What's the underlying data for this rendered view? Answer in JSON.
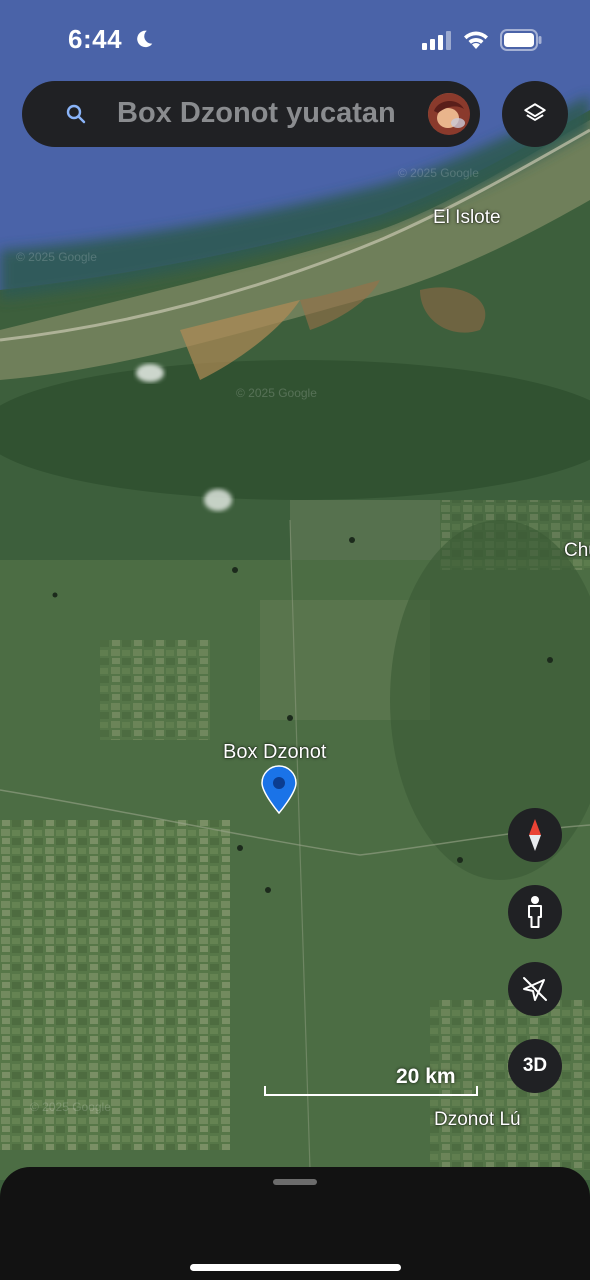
{
  "status_bar": {
    "time": "6:44",
    "icons": [
      "moon-icon",
      "cellular-signal-icon",
      "wifi-icon",
      "battery-icon"
    ]
  },
  "search": {
    "query": "Box Dzonot yucatan",
    "icon": "search-icon"
  },
  "controls": {
    "layers_icon": "layers-icon",
    "compass_icon": "compass-icon",
    "street_view_icon": "pegman-icon",
    "location_icon": "location-off-icon",
    "three_d_label": "3D"
  },
  "map": {
    "place_labels": {
      "el_islote": "El Islote",
      "chu": "Chu",
      "box_dzonot": "Box Dzonot",
      "dzonot_lu": "Dzonot Lú"
    },
    "scale_label": "20 km",
    "watermark": "© 2025 Google",
    "colors": {
      "sea": "#4a63a8",
      "pin": "#1a73e8"
    }
  }
}
